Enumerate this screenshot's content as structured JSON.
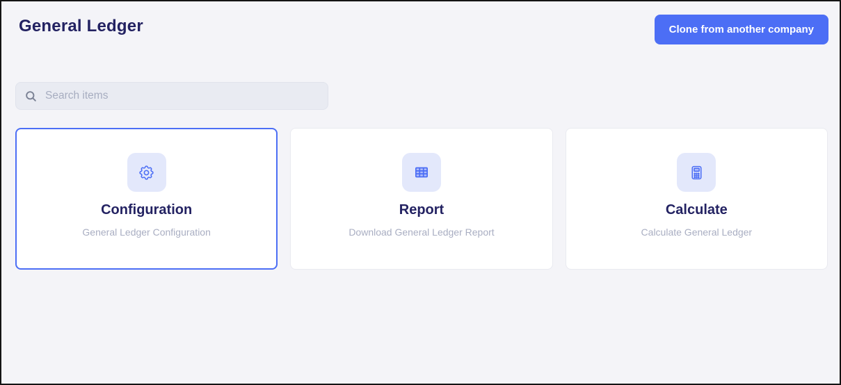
{
  "header": {
    "title": "General Ledger",
    "clone_button_label": "Clone from another company"
  },
  "search": {
    "placeholder": "Search items",
    "icon": "search-icon"
  },
  "cards": [
    {
      "id": "configuration",
      "title": "Configuration",
      "subtitle": "General Ledger Configuration",
      "icon": "gear-icon",
      "selected": true
    },
    {
      "id": "report",
      "title": "Report",
      "subtitle": "Download General Ledger Report",
      "icon": "table-icon",
      "selected": false
    },
    {
      "id": "calculate",
      "title": "Calculate",
      "subtitle": "Calculate General Ledger",
      "icon": "calculator-icon",
      "selected": false
    }
  ],
  "colors": {
    "accent": "#4c6ef5",
    "title_navy": "#232262",
    "page_background": "#f4f4f8",
    "icon_box_background": "#e3e8fb",
    "search_background": "#e9ebf2",
    "subtitle_gray": "#a9aec2"
  }
}
